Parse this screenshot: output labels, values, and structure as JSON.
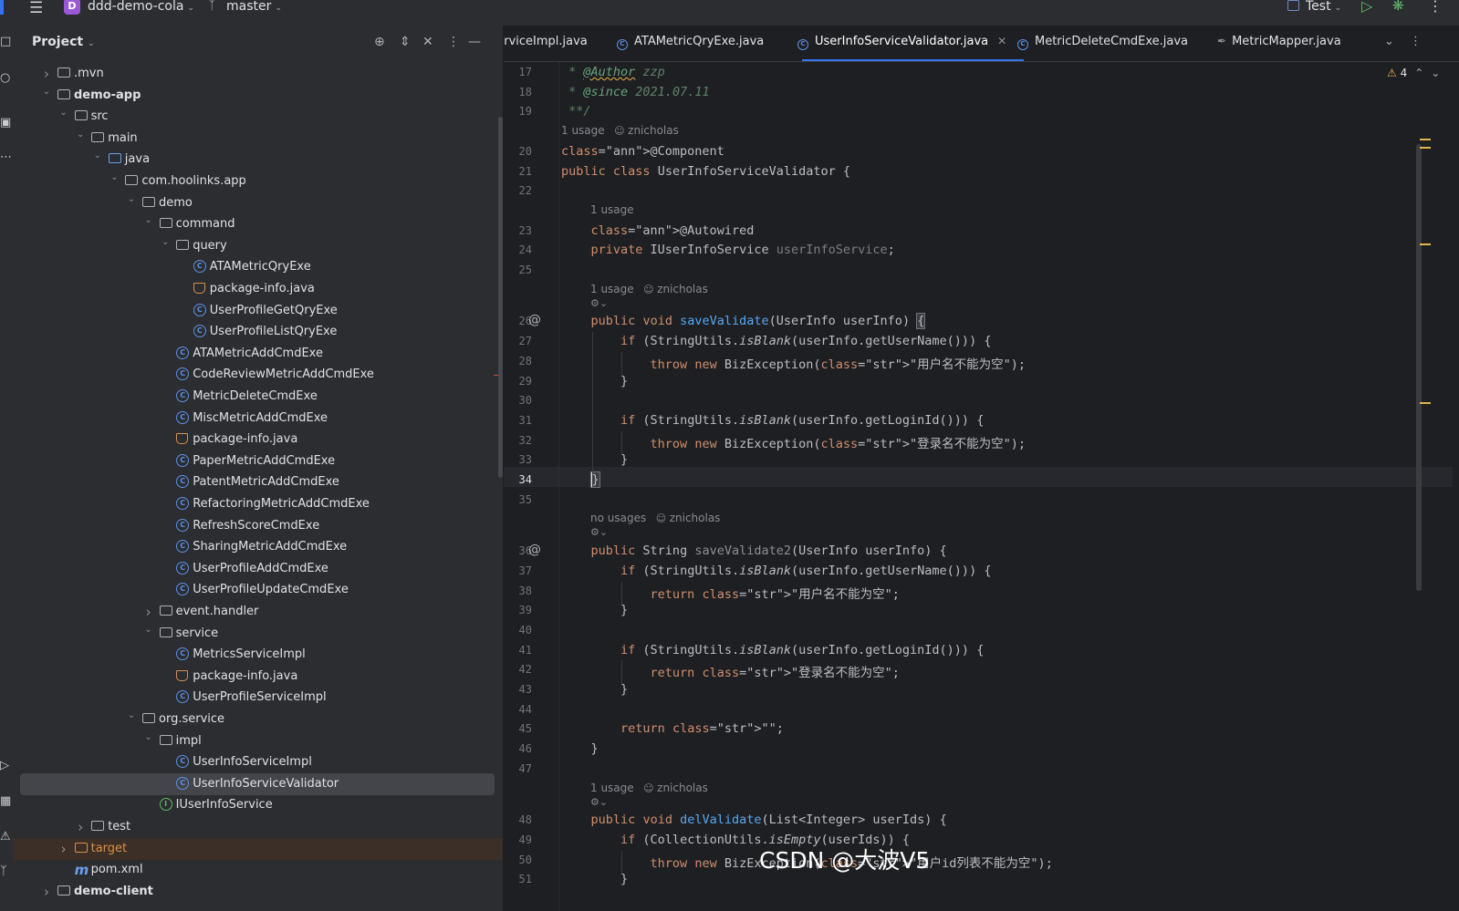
{
  "topbar": {
    "project_badge": "D",
    "project_name": "ddd-demo-cola",
    "branch": "master",
    "run_config": "Test"
  },
  "project_panel": {
    "title": "Project",
    "tree": [
      {
        "label": ".mvn",
        "type": "folder",
        "depth": 1,
        "expanded": false
      },
      {
        "label": "demo-app",
        "type": "module",
        "depth": 1,
        "expanded": true,
        "bold": true
      },
      {
        "label": "src",
        "type": "folder",
        "depth": 2,
        "expanded": true
      },
      {
        "label": "main",
        "type": "folder",
        "depth": 3,
        "expanded": true
      },
      {
        "label": "java",
        "type": "folder-blue",
        "depth": 4,
        "expanded": true
      },
      {
        "label": "com.hoolinks.app",
        "type": "package",
        "depth": 5,
        "expanded": true
      },
      {
        "label": "demo",
        "type": "package",
        "depth": 6,
        "expanded": true
      },
      {
        "label": "command",
        "type": "package",
        "depth": 7,
        "expanded": true
      },
      {
        "label": "query",
        "type": "package",
        "depth": 8,
        "expanded": true
      },
      {
        "label": "ATAMetricQryExe",
        "type": "class",
        "depth": 9
      },
      {
        "label": "package-info.java",
        "type": "java",
        "depth": 9
      },
      {
        "label": "UserProfileGetQryExe",
        "type": "class",
        "depth": 9
      },
      {
        "label": "UserProfileListQryExe",
        "type": "class",
        "depth": 9
      },
      {
        "label": "ATAMetricAddCmdExe",
        "type": "class",
        "depth": 8
      },
      {
        "label": "CodeReviewMetricAddCmdExe",
        "type": "class",
        "depth": 8
      },
      {
        "label": "MetricDeleteCmdExe",
        "type": "class",
        "depth": 8
      },
      {
        "label": "MiscMetricAddCmdExe",
        "type": "class",
        "depth": 8
      },
      {
        "label": "package-info.java",
        "type": "java",
        "depth": 8
      },
      {
        "label": "PaperMetricAddCmdExe",
        "type": "class",
        "depth": 8
      },
      {
        "label": "PatentMetricAddCmdExe",
        "type": "class",
        "depth": 8
      },
      {
        "label": "RefactoringMetricAddCmdExe",
        "type": "class",
        "depth": 8
      },
      {
        "label": "RefreshScoreCmdExe",
        "type": "class",
        "depth": 8
      },
      {
        "label": "SharingMetricAddCmdExe",
        "type": "class",
        "depth": 8
      },
      {
        "label": "UserProfileAddCmdExe",
        "type": "class",
        "depth": 8
      },
      {
        "label": "UserProfileUpdateCmdExe",
        "type": "class",
        "depth": 8
      },
      {
        "label": "event.handler",
        "type": "package",
        "depth": 7,
        "expanded": false
      },
      {
        "label": "service",
        "type": "package",
        "depth": 7,
        "expanded": true
      },
      {
        "label": "MetricsServiceImpl",
        "type": "class",
        "depth": 8
      },
      {
        "label": "package-info.java",
        "type": "java",
        "depth": 8
      },
      {
        "label": "UserProfileServiceImpl",
        "type": "class",
        "depth": 8
      },
      {
        "label": "org.service",
        "type": "package",
        "depth": 6,
        "expanded": true
      },
      {
        "label": "impl",
        "type": "package",
        "depth": 7,
        "expanded": true
      },
      {
        "label": "UserInfoServiceImpl",
        "type": "class",
        "depth": 8
      },
      {
        "label": "UserInfoServiceValidator",
        "type": "class",
        "depth": 8,
        "selected": true
      },
      {
        "label": "IUserInfoService",
        "type": "interface",
        "depth": 7
      },
      {
        "label": "test",
        "type": "folder",
        "depth": 3,
        "expanded": false
      },
      {
        "label": "target",
        "type": "folder-orange",
        "depth": 2,
        "expanded": false,
        "excluded": true
      },
      {
        "label": "pom.xml",
        "type": "maven",
        "depth": 2
      },
      {
        "label": "demo-client",
        "type": "module",
        "depth": 1,
        "expanded": false,
        "bold": true
      }
    ]
  },
  "tabs": [
    {
      "label": "ServiceImpl.java",
      "icon": "class-icon"
    },
    {
      "label": "ATAMetricQryExe.java",
      "icon": "class-icon"
    },
    {
      "label": "UserInfoServiceValidator.java",
      "icon": "class-icon",
      "active": true
    },
    {
      "label": "MetricDeleteCmdExe.java",
      "icon": "class-icon"
    },
    {
      "label": "MetricMapper.java",
      "icon": "mapper-icon"
    }
  ],
  "editor": {
    "warning_count": "4",
    "current_line": 34,
    "hints": {
      "usage_1": "1 usage",
      "no_usages": "no usages",
      "author": "znicholas"
    },
    "lines": [
      {
        "n": 17,
        "text": " * @Author zzp"
      },
      {
        "n": 18,
        "text": " * @since 2021.07.11"
      },
      {
        "n": 19,
        "text": " **/"
      },
      {
        "n": 20,
        "text": "@Component"
      },
      {
        "n": 21,
        "text": "public class UserInfoServiceValidator {"
      },
      {
        "n": 22,
        "text": ""
      },
      {
        "n": 23,
        "text": "    @Autowired"
      },
      {
        "n": 24,
        "text": "    private IUserInfoService userInfoService;"
      },
      {
        "n": 25,
        "text": ""
      },
      {
        "n": 26,
        "text": "    public void saveValidate(UserInfo userInfo) {"
      },
      {
        "n": 27,
        "text": "        if (StringUtils.isBlank(userInfo.getUserName())) {"
      },
      {
        "n": 28,
        "text": "            throw new BizException(\"用户名不能为空\");"
      },
      {
        "n": 29,
        "text": "        }"
      },
      {
        "n": 30,
        "text": ""
      },
      {
        "n": 31,
        "text": "        if (StringUtils.isBlank(userInfo.getLoginId())) {"
      },
      {
        "n": 32,
        "text": "            throw new BizException(\"登录名不能为空\");"
      },
      {
        "n": 33,
        "text": "        }"
      },
      {
        "n": 34,
        "text": "    }"
      },
      {
        "n": 35,
        "text": ""
      },
      {
        "n": 36,
        "text": "    public String saveValidate2(UserInfo userInfo) {"
      },
      {
        "n": 37,
        "text": "        if (StringUtils.isBlank(userInfo.getUserName())) {"
      },
      {
        "n": 38,
        "text": "            return \"用户名不能为空\";"
      },
      {
        "n": 39,
        "text": "        }"
      },
      {
        "n": 40,
        "text": ""
      },
      {
        "n": 41,
        "text": "        if (StringUtils.isBlank(userInfo.getLoginId())) {"
      },
      {
        "n": 42,
        "text": "            return \"登录名不能为空\";"
      },
      {
        "n": 43,
        "text": "        }"
      },
      {
        "n": 44,
        "text": ""
      },
      {
        "n": 45,
        "text": "        return \"\";"
      },
      {
        "n": 46,
        "text": "    }"
      },
      {
        "n": 47,
        "text": ""
      },
      {
        "n": 48,
        "text": "    public void delValidate(List<Integer> userIds) {"
      },
      {
        "n": 49,
        "text": "        if (CollectionUtils.isEmpty(userIds)) {"
      },
      {
        "n": 50,
        "text": "            throw new BizException(\"用户id列表不能为空\");"
      },
      {
        "n": 51,
        "text": "        }"
      }
    ]
  },
  "watermark": "CSDN @大波V5",
  "colors": {
    "accent": "#3574f0",
    "keyword": "#cf8e6d",
    "string": "#6aab73",
    "annotation": "#b3ae60",
    "method": "#56a8f5",
    "doc_comment": "#5f826b"
  }
}
